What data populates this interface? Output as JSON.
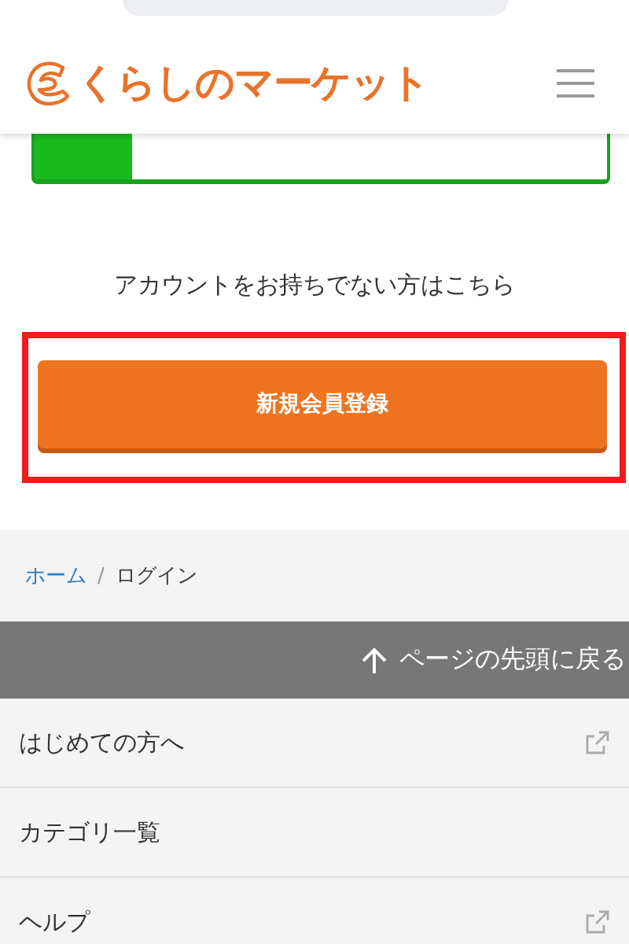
{
  "header": {
    "logo": "くらしのマーケット"
  },
  "signup": {
    "prompt": "アカウントをお持ちでない方はこちら",
    "button": "新規会員登録",
    "highlighted": true
  },
  "breadcrumb_separator": "/",
  "breadcrumb": [
    {
      "label": "ホーム",
      "link": true
    },
    {
      "label": "ログイン",
      "link": false
    }
  ],
  "back_to_top": "ページの先頭に戻る",
  "footer_links": [
    {
      "label": "はじめての方へ",
      "external": true
    },
    {
      "label": "カテゴリ一覧",
      "external": false
    },
    {
      "label": "ヘルプ",
      "external": true
    }
  ]
}
